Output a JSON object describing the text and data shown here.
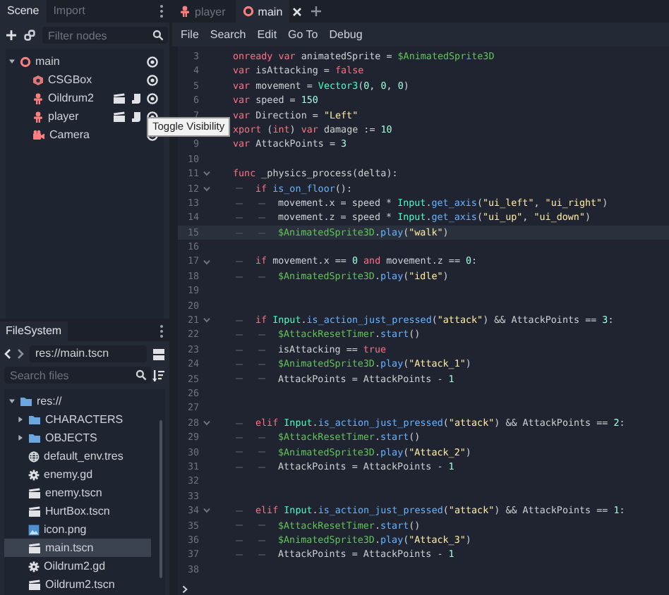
{
  "scene_dock": {
    "tabs": [
      {
        "label": "Scene",
        "selected": true
      },
      {
        "label": "Import",
        "selected": false
      }
    ],
    "filter": {
      "placeholder": "Filter nodes"
    },
    "tree": [
      {
        "label": "main",
        "kind": "root",
        "expanded": true,
        "visible": true,
        "children": [
          {
            "label": "CSGBox",
            "kind": "csg",
            "visible": true,
            "instanced": false,
            "scripted": false
          },
          {
            "label": "Oildrum2",
            "kind": "sprite",
            "visible": true,
            "instanced": true,
            "scripted": true
          },
          {
            "label": "player",
            "kind": "sprite",
            "visible": true,
            "instanced": true,
            "scripted": true
          },
          {
            "label": "Camera",
            "kind": "camera",
            "visible": true,
            "instanced": false,
            "scripted": false
          }
        ]
      }
    ]
  },
  "tooltip": "Toggle Visibility",
  "filesystem": {
    "title": "FileSystem",
    "path": "res://main.tscn",
    "search": {
      "placeholder": "Search files"
    },
    "tree": [
      {
        "label": "res://",
        "kind": "folder",
        "expanded": true,
        "selected": false,
        "children": [
          {
            "label": "CHARACTERS",
            "kind": "folder",
            "expanded": false,
            "selected": false
          },
          {
            "label": "OBJECTS",
            "kind": "folder",
            "expanded": false,
            "selected": false
          },
          {
            "label": "default_env.tres",
            "kind": "environment",
            "selected": false
          },
          {
            "label": "enemy.gd",
            "kind": "script",
            "selected": false
          },
          {
            "label": "enemy.tscn",
            "kind": "scene",
            "selected": false
          },
          {
            "label": "HurtBox.tscn",
            "kind": "scene",
            "selected": false
          },
          {
            "label": "icon.png",
            "kind": "image",
            "selected": false
          },
          {
            "label": "main.tscn",
            "kind": "scene",
            "selected": true
          },
          {
            "label": "Oildrum2.gd",
            "kind": "script",
            "selected": false
          },
          {
            "label": "Oildrum2.tscn",
            "kind": "scene",
            "selected": false
          }
        ]
      }
    ]
  },
  "editor": {
    "tabs": [
      {
        "label": "player",
        "kind": "sprite",
        "selected": false
      },
      {
        "label": "main",
        "kind": "root",
        "selected": true
      }
    ],
    "menu": [
      "File",
      "Search",
      "Edit",
      "Go To",
      "Debug"
    ],
    "lines": [
      {
        "number": "3",
        "fold": false,
        "current": false,
        "code": [
          {
            "kind": "keyword",
            "text": "onready var"
          },
          {
            "kind": "text",
            "text": " animatedSprite = "
          },
          {
            "kind": "node",
            "text": "$AnimatedSprite3D"
          }
        ]
      },
      {
        "number": "4",
        "fold": false,
        "current": false,
        "code": [
          {
            "kind": "keyword",
            "text": "var"
          },
          {
            "kind": "text",
            "text": " isAttacking = "
          },
          {
            "kind": "keyword",
            "text": "false"
          }
        ]
      },
      {
        "number": "5",
        "fold": false,
        "current": false,
        "code": [
          {
            "kind": "keyword",
            "text": "var"
          },
          {
            "kind": "text",
            "text": " movement = "
          },
          {
            "kind": "type",
            "text": "Vector3"
          },
          {
            "kind": "text",
            "text": "("
          },
          {
            "kind": "number",
            "text": "0"
          },
          {
            "kind": "text",
            "text": ", "
          },
          {
            "kind": "number",
            "text": "0"
          },
          {
            "kind": "text",
            "text": ", "
          },
          {
            "kind": "number",
            "text": "0"
          },
          {
            "kind": "text",
            "text": ")"
          }
        ]
      },
      {
        "number": "6",
        "fold": false,
        "current": false,
        "code": [
          {
            "kind": "keyword",
            "text": "var"
          },
          {
            "kind": "text",
            "text": " speed = "
          },
          {
            "kind": "number",
            "text": "150"
          }
        ]
      },
      {
        "number": "7",
        "fold": false,
        "current": false,
        "code": [
          {
            "kind": "keyword",
            "text": "var"
          },
          {
            "kind": "text",
            "text": " Direction = "
          },
          {
            "kind": "string",
            "text": "\"Left\""
          }
        ]
      },
      {
        "fold": false,
        "current": false,
        "code": [
          {
            "kind": "keyword",
            "text": "xport"
          },
          {
            "kind": "text",
            "text": " ("
          },
          {
            "kind": "keyword",
            "text": "int"
          },
          {
            "kind": "text",
            "text": ") "
          },
          {
            "kind": "keyword",
            "text": "var"
          },
          {
            "kind": "text",
            "text": " damage := "
          },
          {
            "kind": "number",
            "text": "10"
          }
        ]
      },
      {
        "number": "9",
        "fold": false,
        "current": false,
        "code": [
          {
            "kind": "keyword",
            "text": "var"
          },
          {
            "kind": "text",
            "text": " AttackPoints = "
          },
          {
            "kind": "number",
            "text": "3"
          }
        ]
      },
      {
        "number": "10",
        "fold": false,
        "current": false
      },
      {
        "number": "11",
        "fold": true,
        "current": false,
        "code": [
          {
            "kind": "keyword",
            "text": "func"
          },
          {
            "kind": "text",
            "text": " _physics_process(delta):"
          }
        ]
      },
      {
        "number": "12",
        "fold": true,
        "current": false,
        "code": [
          {
            "kind": "keyword",
            "text": "\tif "
          },
          {
            "kind": "call",
            "text": "is_on_floor"
          },
          {
            "kind": "text",
            "text": "():"
          }
        ]
      },
      {
        "number": "13",
        "fold": false,
        "current": false,
        "code": [
          {
            "kind": "text",
            "text": "\t\tmovement.x = speed * "
          },
          {
            "kind": "type",
            "text": "Input"
          },
          {
            "kind": "text",
            "text": "."
          },
          {
            "kind": "call",
            "text": "get_axis"
          },
          {
            "kind": "text",
            "text": "("
          },
          {
            "kind": "string",
            "text": "\"ui_left\""
          },
          {
            "kind": "text",
            "text": ", "
          },
          {
            "kind": "string",
            "text": "\"ui_right\""
          },
          {
            "kind": "text",
            "text": ")"
          }
        ]
      },
      {
        "number": "14",
        "fold": false,
        "current": false,
        "code": [
          {
            "kind": "text",
            "text": "\t\tmovement.z = speed * "
          },
          {
            "kind": "type",
            "text": "Input"
          },
          {
            "kind": "text",
            "text": "."
          },
          {
            "kind": "call",
            "text": "get_axis"
          },
          {
            "kind": "text",
            "text": "("
          },
          {
            "kind": "string",
            "text": "\"ui_up\""
          },
          {
            "kind": "text",
            "text": ", "
          },
          {
            "kind": "string",
            "text": "\"ui_down\""
          },
          {
            "kind": "text",
            "text": ")"
          }
        ]
      },
      {
        "number": "15",
        "fold": false,
        "current": true,
        "code": [
          {
            "kind": "node",
            "text": "\t\t$AnimatedSprite3D"
          },
          {
            "kind": "text",
            "text": "."
          },
          {
            "kind": "call",
            "text": "play"
          },
          {
            "kind": "text",
            "text": "("
          },
          {
            "kind": "string",
            "text": "\"walk\""
          },
          {
            "kind": "text",
            "text": ")"
          }
        ]
      },
      {
        "number": "16",
        "fold": false,
        "current": false
      },
      {
        "number": "17",
        "fold": true,
        "current": false,
        "code": [
          {
            "kind": "keyword",
            "text": "\tif"
          },
          {
            "kind": "text",
            "text": " movement.x == "
          },
          {
            "kind": "number",
            "text": "0"
          },
          {
            "kind": "keyword",
            "text": " and"
          },
          {
            "kind": "text",
            "text": " movement.z == "
          },
          {
            "kind": "number",
            "text": "0"
          },
          {
            "kind": "text",
            "text": ":"
          }
        ]
      },
      {
        "number": "18",
        "fold": false,
        "current": false,
        "code": [
          {
            "kind": "node",
            "text": "\t\t$AnimatedSprite3D"
          },
          {
            "kind": "text",
            "text": "."
          },
          {
            "kind": "call",
            "text": "play"
          },
          {
            "kind": "text",
            "text": "("
          },
          {
            "kind": "string",
            "text": "\"idle\""
          },
          {
            "kind": "text",
            "text": ")"
          }
        ]
      },
      {
        "number": "19",
        "fold": false,
        "current": false
      },
      {
        "number": "20",
        "fold": false,
        "current": false
      },
      {
        "number": "21",
        "fold": true,
        "current": false,
        "code": [
          {
            "kind": "keyword",
            "text": "\tif "
          },
          {
            "kind": "type",
            "text": "Input"
          },
          {
            "kind": "text",
            "text": "."
          },
          {
            "kind": "call",
            "text": "is_action_just_pressed"
          },
          {
            "kind": "text",
            "text": "("
          },
          {
            "kind": "string",
            "text": "\"attack\""
          },
          {
            "kind": "text",
            "text": ") && AttackPoints == "
          },
          {
            "kind": "number",
            "text": "3"
          },
          {
            "kind": "text",
            "text": ":"
          }
        ]
      },
      {
        "number": "22",
        "fold": false,
        "current": false,
        "code": [
          {
            "kind": "node",
            "text": "\t\t$AttackResetTimer"
          },
          {
            "kind": "text",
            "text": "."
          },
          {
            "kind": "call",
            "text": "start"
          },
          {
            "kind": "text",
            "text": "()"
          }
        ]
      },
      {
        "number": "23",
        "fold": false,
        "current": false,
        "code": [
          {
            "kind": "text",
            "text": "\t\tisAttacking == "
          },
          {
            "kind": "keyword",
            "text": "true"
          }
        ]
      },
      {
        "number": "24",
        "fold": false,
        "current": false,
        "code": [
          {
            "kind": "node",
            "text": "\t\t$AnimatedSprite3D"
          },
          {
            "kind": "text",
            "text": "."
          },
          {
            "kind": "call",
            "text": "play"
          },
          {
            "kind": "text",
            "text": "("
          },
          {
            "kind": "string",
            "text": "\"Attack_1\""
          },
          {
            "kind": "text",
            "text": ")"
          }
        ]
      },
      {
        "number": "25",
        "fold": false,
        "current": false,
        "code": [
          {
            "kind": "text",
            "text": "\t\tAttackPoints = AttackPoints - "
          },
          {
            "kind": "number",
            "text": "1"
          }
        ]
      },
      {
        "number": "26",
        "fold": false,
        "current": false
      },
      {
        "number": "27",
        "fold": false,
        "current": false
      },
      {
        "number": "28",
        "fold": true,
        "current": false,
        "code": [
          {
            "kind": "keyword",
            "text": "\telif "
          },
          {
            "kind": "type",
            "text": "Input"
          },
          {
            "kind": "text",
            "text": "."
          },
          {
            "kind": "call",
            "text": "is_action_just_pressed"
          },
          {
            "kind": "text",
            "text": "("
          },
          {
            "kind": "string",
            "text": "\"attack\""
          },
          {
            "kind": "text",
            "text": ") && AttackPoints == "
          },
          {
            "kind": "number",
            "text": "2"
          },
          {
            "kind": "text",
            "text": ":"
          }
        ]
      },
      {
        "number": "29",
        "fold": false,
        "current": false,
        "code": [
          {
            "kind": "node",
            "text": "\t\t$AttackResetTimer"
          },
          {
            "kind": "text",
            "text": "."
          },
          {
            "kind": "call",
            "text": "start"
          },
          {
            "kind": "text",
            "text": "()"
          }
        ]
      },
      {
        "number": "30",
        "fold": false,
        "current": false,
        "code": [
          {
            "kind": "node",
            "text": "\t\t$AnimatedSprite3D"
          },
          {
            "kind": "text",
            "text": "."
          },
          {
            "kind": "call",
            "text": "play"
          },
          {
            "kind": "text",
            "text": "("
          },
          {
            "kind": "string",
            "text": "\"Attack_2\""
          },
          {
            "kind": "text",
            "text": ")"
          }
        ]
      },
      {
        "number": "31",
        "fold": false,
        "current": false,
        "code": [
          {
            "kind": "text",
            "text": "\t\tAttackPoints = AttackPoints - "
          },
          {
            "kind": "number",
            "text": "1"
          }
        ]
      },
      {
        "number": "32",
        "fold": false,
        "current": false
      },
      {
        "number": "33",
        "fold": false,
        "current": false
      },
      {
        "number": "34",
        "fold": true,
        "current": false,
        "code": [
          {
            "kind": "keyword",
            "text": "\telif "
          },
          {
            "kind": "type",
            "text": "Input"
          },
          {
            "kind": "text",
            "text": "."
          },
          {
            "kind": "call",
            "text": "is_action_just_pressed"
          },
          {
            "kind": "text",
            "text": "("
          },
          {
            "kind": "string",
            "text": "\"attack\""
          },
          {
            "kind": "text",
            "text": ") && AttackPoints == "
          },
          {
            "kind": "number",
            "text": "1"
          },
          {
            "kind": "text",
            "text": ":"
          }
        ]
      },
      {
        "number": "35",
        "fold": false,
        "current": false,
        "code": [
          {
            "kind": "node",
            "text": "\t\t$AttackResetTimer"
          },
          {
            "kind": "text",
            "text": "."
          },
          {
            "kind": "call",
            "text": "start"
          },
          {
            "kind": "text",
            "text": "()"
          }
        ]
      },
      {
        "number": "36",
        "fold": false,
        "current": false,
        "code": [
          {
            "kind": "node",
            "text": "\t\t$AnimatedSprite3D"
          },
          {
            "kind": "text",
            "text": "."
          },
          {
            "kind": "call",
            "text": "play"
          },
          {
            "kind": "text",
            "text": "("
          },
          {
            "kind": "string",
            "text": "\"Attack_3\""
          },
          {
            "kind": "text",
            "text": ")"
          }
        ]
      },
      {
        "number": "37",
        "fold": false,
        "current": false,
        "code": [
          {
            "kind": "text",
            "text": "\t\tAttackPoints = AttackPoints - "
          },
          {
            "kind": "number",
            "text": "1"
          }
        ]
      },
      {
        "number": "38",
        "fold": false,
        "current": false
      }
    ]
  }
}
